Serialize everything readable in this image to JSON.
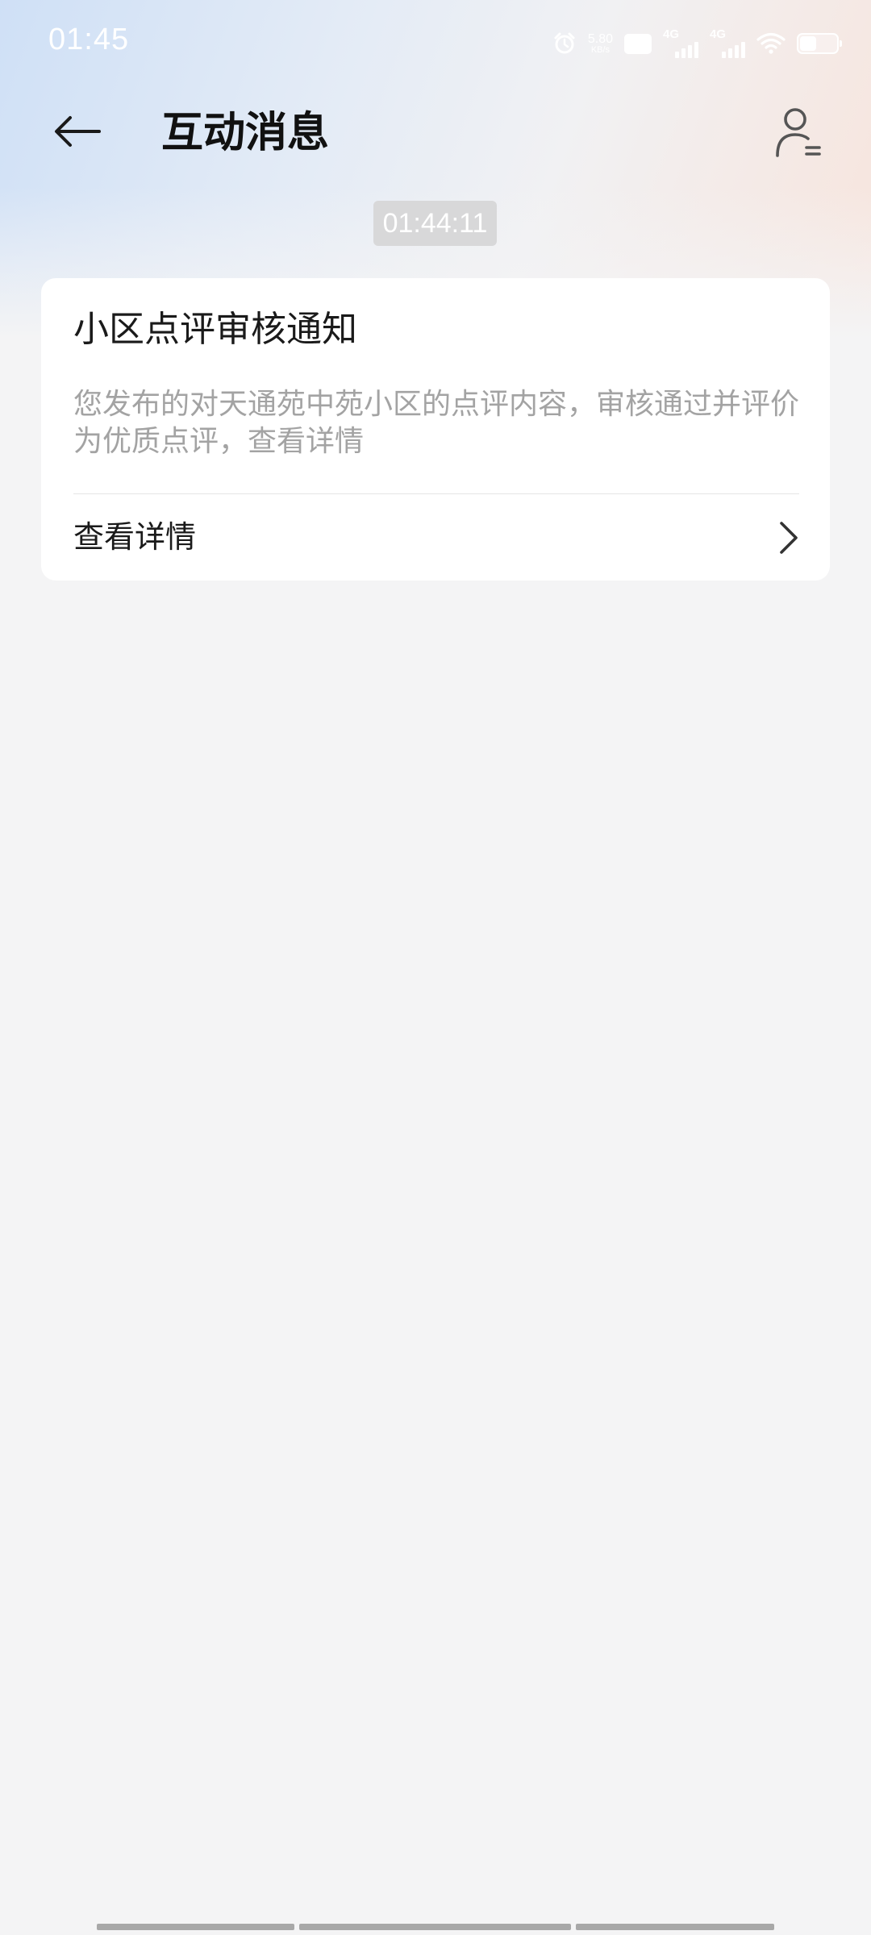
{
  "status_bar": {
    "time": "01:45",
    "net_speed_value": "5.80",
    "net_speed_unit": "KB/s",
    "hd_label": "HD",
    "signal_1_label": "4G",
    "signal_2_label": "4G",
    "battery_level": 0.45,
    "icons": [
      "alarm-icon",
      "hd-volte-icon",
      "signal-4g-icon",
      "signal-4g-icon",
      "wifi-icon",
      "battery-icon"
    ]
  },
  "header": {
    "title": "互动消息",
    "back_icon": "arrow-left-icon",
    "profile_icon": "user-list-icon"
  },
  "messages": [
    {
      "timestamp": "01:44:11",
      "title": "小区点评审核通知",
      "body": "您发布的对天通苑中苑小区的点评内容，审核通过并评价为优质点评，查看详情",
      "action_label": "查看详情",
      "action_icon": "chevron-right-icon"
    }
  ],
  "colors": {
    "background": "#f4f4f5",
    "card": "#ffffff",
    "title_text": "#111111",
    "body_text": "#a3a3a3",
    "timestamp_chip": "#d8d8d9"
  }
}
